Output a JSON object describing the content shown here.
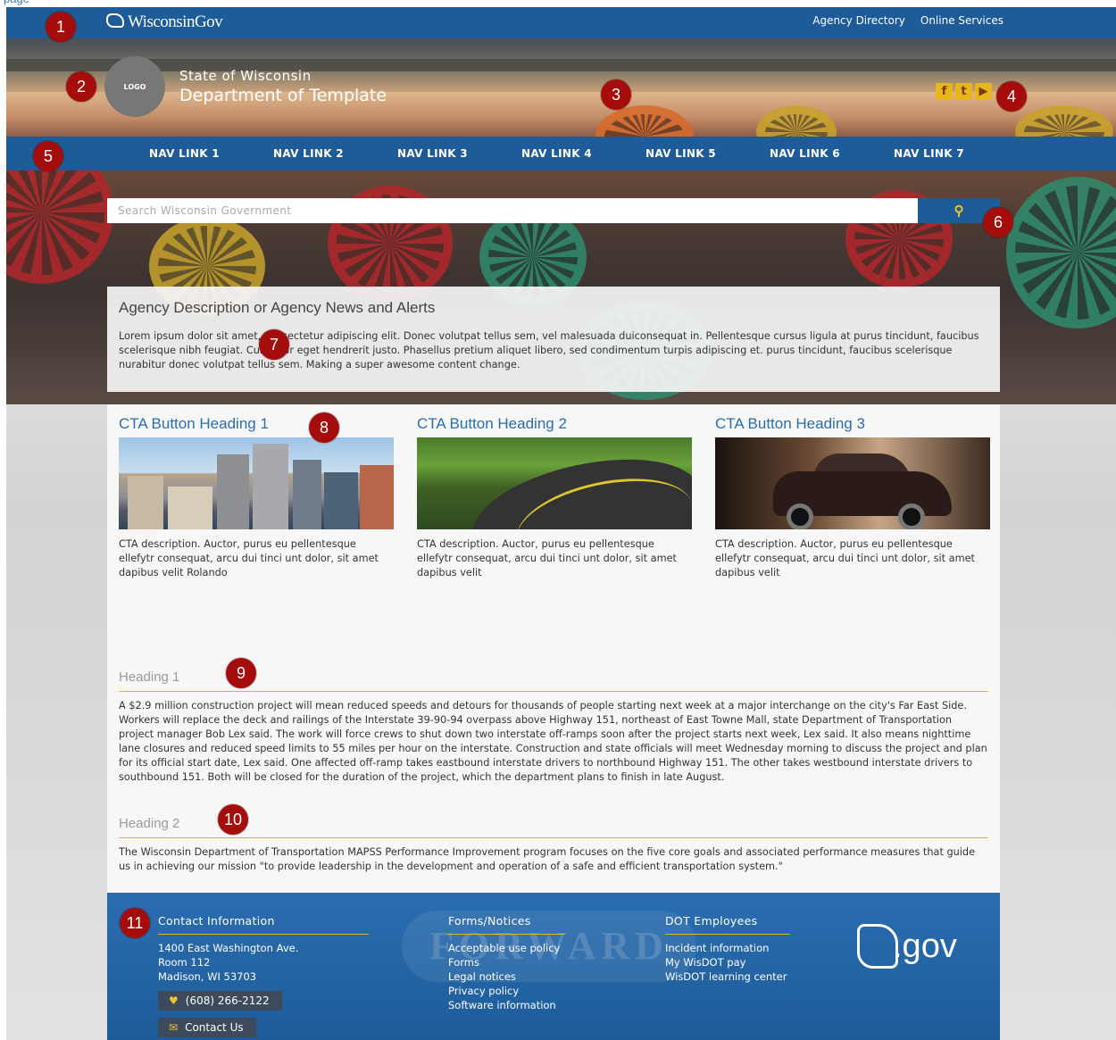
{
  "page_label": "page",
  "header": {
    "site_logo": "WisconsinGov",
    "util_links": [
      "Agency Directory",
      "Online Services"
    ],
    "logo_text": "LOGO",
    "state_name": "State of Wisconsin",
    "dept_name": "Department of Template",
    "social_icons": [
      "facebook-icon",
      "twitter-icon",
      "youtube-icon"
    ]
  },
  "nav": {
    "items": [
      "NAV LINK 1",
      "NAV LINK 2",
      "NAV LINK 3",
      "NAV LINK 4",
      "NAV LINK 5",
      "NAV LINK 6",
      "NAV LINK 7"
    ]
  },
  "search": {
    "placeholder": "Search Wisconsin Government",
    "button_icon": "search-icon"
  },
  "description": {
    "title": "Agency Description or Agency News and Alerts",
    "body": "Lorem ipsum dolor sit amet, consectetur adipiscing elit. Donec volutpat tellus sem, vel malesuada duiconsequat in. Pellentesque cursus ligula at purus tincidunt, faucibus scelerisque nibh feugiat. Curabitur eget hendrerit justo. Phasellus pretium aliquet libero, sed condimentum turpis adipiscing et. purus tincidunt, faucibus scelerisque nurabitur donec volutpat tellus sem. Making a super awesome content change."
  },
  "cta": [
    {
      "heading": "CTA Button Heading 1",
      "description": "CTA  description. Auctor, purus eu pellentesque  ellefytr consequat, arcu dui tinci unt dolor, sit amet dapibus velit Rolando"
    },
    {
      "heading": "CTA Button Heading 2",
      "description": "CTA  description. Auctor, purus eu pellentesque  ellefytr consequat, arcu dui tinci unt dolor, sit amet dapibus velit"
    },
    {
      "heading": "CTA Button Heading 3",
      "description": "CTA  description. Auctor, purus eu pellentesque  ellefytr consequat, arcu dui tinci unt dolor, sit amet dapibus velit"
    }
  ],
  "sections": [
    {
      "heading": "Heading 1",
      "body": "A $2.9 million construction project will mean reduced speeds and detours for thousands of people starting next week at a major interchange on the city's Far East Side. Workers will replace the deck and railings of the Interstate 39-90-94 overpass above Highway 151, northeast of East Towne Mall, state Department of Transportation project manager Bob Lex said. The work will force crews to shut down two interstate off-ramps soon after the project starts next week, Lex said. It also means nighttime lane closures and reduced speed limits to 55 miles per hour on the interstate. Construction and state officials will meet Wednesday morning to discuss the project and plan for its official start date, Lex said. One affected off-ramp takes eastbound interstate drivers to northbound Highway 151. The other takes westbound interstate drivers to southbound 151. Both will be closed for the duration of the project, which the department plans to finish in late August."
    },
    {
      "heading": "Heading 2",
      "body": "The Wisconsin Department of Transportation MAPSS Performance Improvement program focuses on the five core goals and associated performance measures that guide us in achieving our mission \"to provide leadership in the development and operation of a safe and efficient transportation system.\""
    }
  ],
  "footer": {
    "watermark": "FORWARD",
    "contact": {
      "title": "Contact Information",
      "address": [
        "1400 East Washington Ave.",
        "Room 112",
        "Madison, WI 53703"
      ],
      "phone": "(608) 266-2122",
      "contact_us": "Contact Us"
    },
    "forms": {
      "title": "Forms/Notices",
      "links": [
        "Acceptable use policy",
        "Forms",
        "Legal notices",
        "Privacy policy",
        "Software information"
      ]
    },
    "employees": {
      "title": "DOT Employees",
      "links": [
        "Incident information",
        "My WisDOT pay",
        "WisDOT learning center"
      ]
    },
    "gov_logo": ".gov"
  },
  "markers": [
    "1",
    "2",
    "3",
    "4",
    "5",
    "6",
    "7",
    "8",
    "9",
    "10",
    "11"
  ],
  "colors": {
    "brand_blue": "#1d5c99",
    "accent_gold": "#e2b91e",
    "cta_heading": "#2a6fb0",
    "marker_red": "#a50d0d"
  }
}
